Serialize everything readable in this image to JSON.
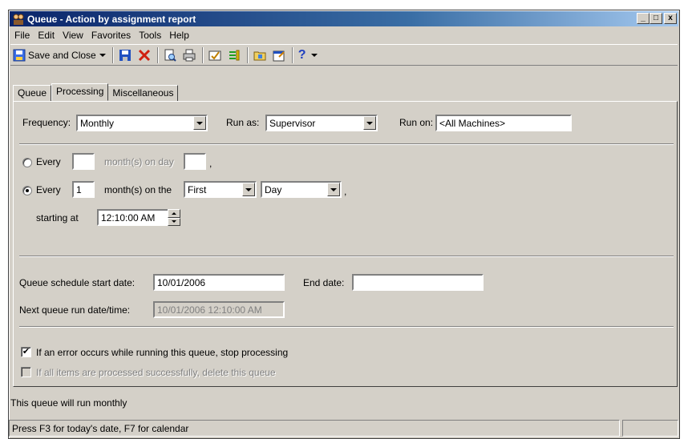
{
  "window": {
    "title": "Queue - Action by assignment report",
    "minimize": "_",
    "maximize": "□",
    "close": "x"
  },
  "menu": [
    "File",
    "Edit",
    "View",
    "Favorites",
    "Tools",
    "Help"
  ],
  "toolbar": {
    "save_close_label": "Save and Close",
    "help_label": "?"
  },
  "tabs": [
    "Queue",
    "Processing",
    "Miscellaneous"
  ],
  "processing": {
    "frequency_label": "Frequency:",
    "frequency_value": "Monthly",
    "run_as_label": "Run as:",
    "run_as_value": "Supervisor",
    "run_on_label": "Run on:",
    "run_on_value": "<All Machines>",
    "option1": {
      "every_label": "Every",
      "every_value": "",
      "day_text": "month(s) on day",
      "day_value": "",
      "comma": ","
    },
    "option2": {
      "every_label": "Every",
      "every_value": "1",
      "on_the_text": "month(s) on the",
      "ordinal_value": "First",
      "day_type_value": "Day",
      "comma": ","
    },
    "starting_at_label": "starting at",
    "starting_at_value": "12:10:00 AM",
    "start_date_label": "Queue schedule start date:",
    "start_date_value": "10/01/2006",
    "end_date_label": "End date:",
    "end_date_value": "",
    "next_run_label": "Next queue run date/time:",
    "next_run_value": "10/01/2006 12:10:00 AM",
    "error_stop_label": "If an error occurs while running this queue, stop processing",
    "delete_label": "If all items are processed successfully, delete this queue"
  },
  "info_text": "This queue will run monthly",
  "status": {
    "hint": "Press F3 for today's date, F7 for calendar",
    "extra": ""
  },
  "colors": {
    "titlebar_start": "#0a246a",
    "titlebar_end": "#a6caf0",
    "face": "#d4d0c8"
  }
}
